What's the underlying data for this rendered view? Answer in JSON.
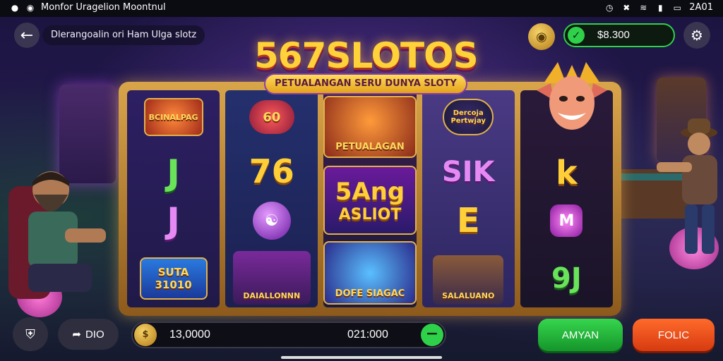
{
  "status_bar": {
    "left_text": "Monfor  Uragelion Moontnul",
    "time": "2A01"
  },
  "header": {
    "title": "Dlerangoalin ori Ham Ulga slotz",
    "balance": "$8.300"
  },
  "logo": {
    "title": "567SLOTOS",
    "subtitle": "PETUALANGAN SERU DUNYA SLOTY"
  },
  "reels": {
    "r1": {
      "top_label": "BCINALPAG",
      "mid1": "J",
      "mid2": "J",
      "bottom_label": "SUTA 31010"
    },
    "r2": {
      "top_label": "60",
      "mid1": "76",
      "bottom_label": "DAIALLONNN"
    },
    "r3": {
      "top_label": "PETUALAGAN",
      "mid_line1": "5Ang",
      "mid_line2": "ASLIOT",
      "bottom_label": "DOFE SIAGAC"
    },
    "r4": {
      "top_label": "Dercoja Pertwjay",
      "mid1": "SIK",
      "mid2": "E",
      "bottom_label": "SALALUANO"
    },
    "r5": {
      "mid1": "k",
      "mid2": "M",
      "bottom": "9J"
    }
  },
  "bottom_bar": {
    "share_label": "DIO",
    "bet_value": "13,0000",
    "win_value": "021:000",
    "spin_label": "AMYAN",
    "auto_label": "FOLIC"
  },
  "colors": {
    "accent_green": "#2fd04a",
    "accent_orange": "#ff6a2a",
    "gold": "#ffcf3a"
  },
  "icons": [
    "back-arrow-icon",
    "coin-icon",
    "check-icon",
    "gear-icon",
    "shield-icon",
    "share-icon",
    "minus-icon"
  ]
}
